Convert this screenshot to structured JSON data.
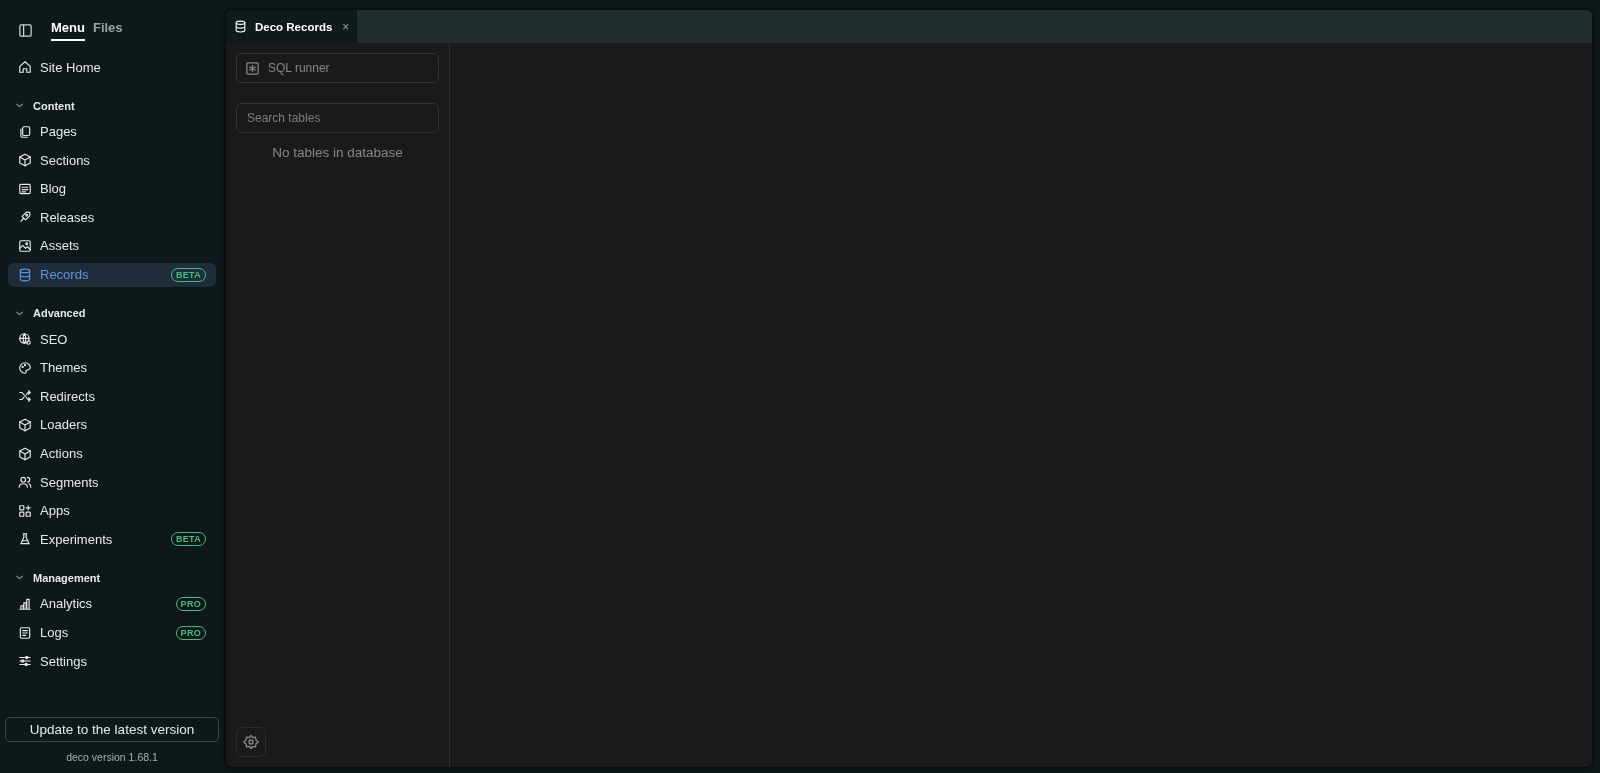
{
  "sidebar": {
    "tabs": [
      {
        "label": "Menu",
        "selected": true
      },
      {
        "label": "Files",
        "selected": false
      }
    ],
    "home": {
      "label": "Site Home",
      "selected": false
    },
    "sections": [
      {
        "title": "Content",
        "expanded": true,
        "items": [
          {
            "label": "Pages",
            "selected": false
          },
          {
            "label": "Sections",
            "selected": false
          },
          {
            "label": "Blog",
            "selected": false
          },
          {
            "label": "Releases",
            "selected": false
          },
          {
            "label": "Assets",
            "selected": false
          },
          {
            "label": "Records",
            "selected": true,
            "badge": "BETA"
          }
        ]
      },
      {
        "title": "Advanced",
        "expanded": true,
        "items": [
          {
            "label": "SEO",
            "selected": false
          },
          {
            "label": "Themes",
            "selected": false
          },
          {
            "label": "Redirects",
            "selected": false
          },
          {
            "label": "Loaders",
            "selected": false
          },
          {
            "label": "Actions",
            "selected": false
          },
          {
            "label": "Segments",
            "selected": false
          },
          {
            "label": "Apps",
            "selected": false
          },
          {
            "label": "Experiments",
            "selected": false,
            "badge": "BETA"
          }
        ]
      },
      {
        "title": "Management",
        "expanded": true,
        "items": [
          {
            "label": "Analytics",
            "selected": false,
            "badge": "PRO"
          },
          {
            "label": "Logs",
            "selected": false,
            "badge": "PRO"
          },
          {
            "label": "Settings",
            "selected": false
          }
        ]
      }
    ],
    "update_button": "Update to the latest version",
    "version": "deco version 1.68.1"
  },
  "editor_tabs": [
    {
      "label": "Deco Records",
      "selected": true,
      "close": "×"
    }
  ],
  "records_panel": {
    "sql_runner": "SQL runner",
    "search": {
      "placeholder": "Search tables"
    },
    "empty_message": "No tables in database"
  }
}
